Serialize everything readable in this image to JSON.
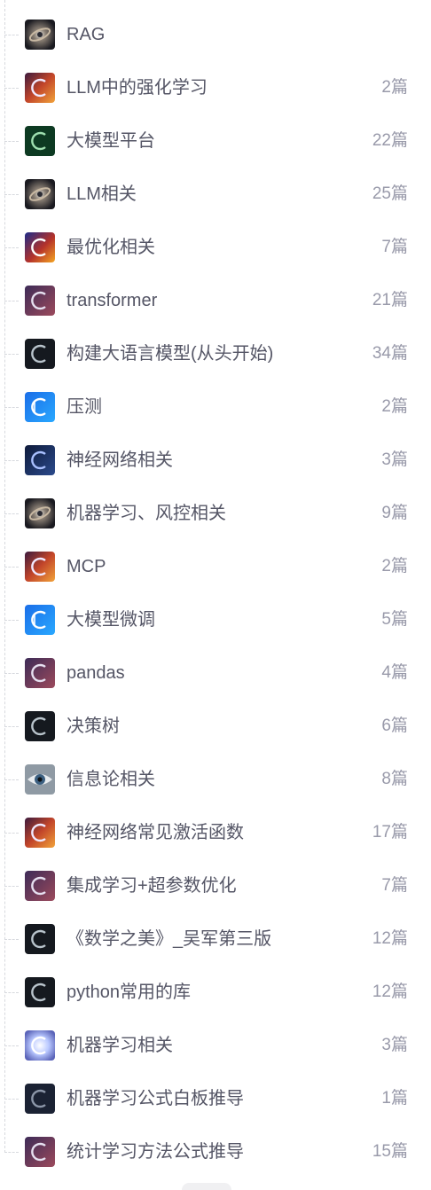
{
  "items": [
    {
      "name": "RAG",
      "count": "",
      "icon": "vortex-thumbnail-icon"
    },
    {
      "name": "LLM中的强化学习",
      "count": "2篇",
      "icon": "fire-c-thumbnail-icon"
    },
    {
      "name": "大模型平台",
      "count": "22篇",
      "icon": "green-c-thumbnail-icon"
    },
    {
      "name": "LLM相关",
      "count": "25篇",
      "icon": "vortex-thumbnail-icon"
    },
    {
      "name": "最优化相关",
      "count": "7篇",
      "icon": "fire-c-thumbnail-icon"
    },
    {
      "name": "transformer",
      "count": "21篇",
      "icon": "purple-c-thumbnail-icon"
    },
    {
      "name": "构建大语言模型(从头开始)",
      "count": "34篇",
      "icon": "dark-c-thumbnail-icon"
    },
    {
      "name": "压测",
      "count": "2篇",
      "icon": "blue-c-thumbnail-icon"
    },
    {
      "name": "神经网络相关",
      "count": "3篇",
      "icon": "dark-c-thumbnail-icon"
    },
    {
      "name": "机器学习、风控相关",
      "count": "9篇",
      "icon": "vortex-thumbnail-icon"
    },
    {
      "name": "MCP",
      "count": "2篇",
      "icon": "fire-c-thumbnail-icon"
    },
    {
      "name": "大模型微调",
      "count": "5篇",
      "icon": "blue-c-thumbnail-icon"
    },
    {
      "name": "pandas",
      "count": "4篇",
      "icon": "purple-c-thumbnail-icon"
    },
    {
      "name": "决策树",
      "count": "6篇",
      "icon": "dark-c-thumbnail-icon"
    },
    {
      "name": "信息论相关",
      "count": "8篇",
      "icon": "eye-thumbnail-icon"
    },
    {
      "name": "神经网络常见激活函数",
      "count": "17篇",
      "icon": "fire-c-thumbnail-icon"
    },
    {
      "name": "集成学习+超参数优化",
      "count": "7篇",
      "icon": "purple-c-thumbnail-icon"
    },
    {
      "name": "《数学之美》_吴军第三版",
      "count": "12篇",
      "icon": "dark-c-thumbnail-icon"
    },
    {
      "name": "python常用的库",
      "count": "12篇",
      "icon": "dark-c-thumbnail-icon"
    },
    {
      "name": "机器学习相关",
      "count": "3篇",
      "icon": "light-c-thumbnail-icon"
    },
    {
      "name": "机器学习公式白板推导",
      "count": "1篇",
      "icon": "navy-c-thumbnail-icon"
    },
    {
      "name": "统计学习方法公式推导",
      "count": "15篇",
      "icon": "purple-c-thumbnail-icon"
    }
  ]
}
